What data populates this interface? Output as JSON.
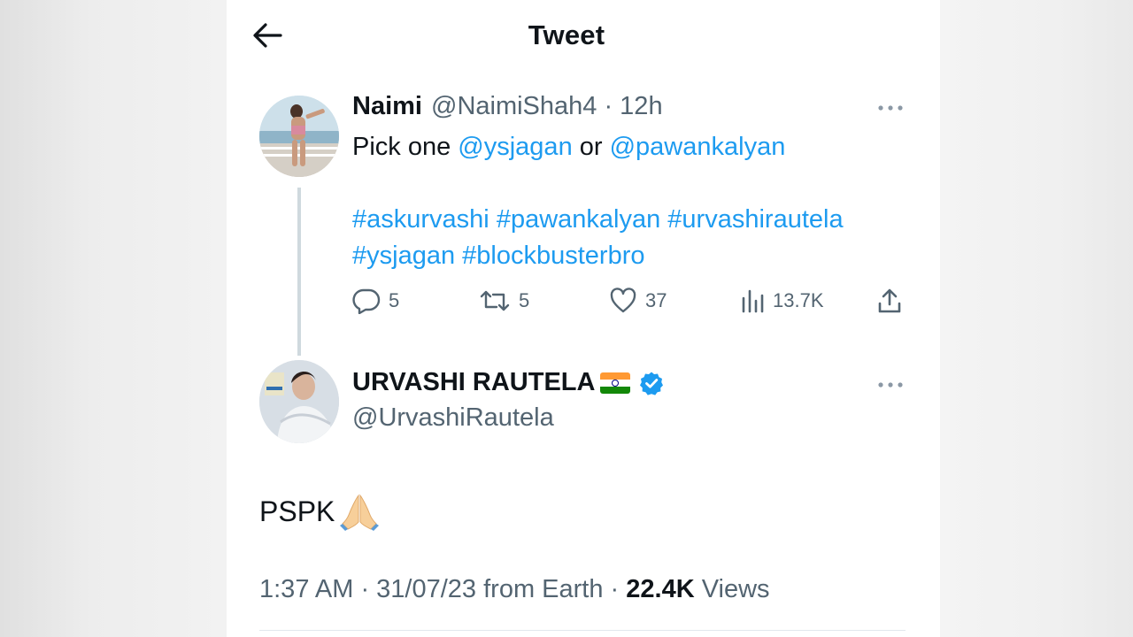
{
  "header": {
    "title": "Tweet",
    "back_icon": "arrow-left-icon"
  },
  "tweet1": {
    "author_name": "Naimi",
    "handle_time": "@NaimiShah4 · 12h",
    "text_prefix": "Pick one ",
    "mention1": "@ysjagan",
    "text_mid": " or ",
    "mention2": "@pawankalyan",
    "hashtags_line1": [
      "#askurvashi",
      "#pawankalyan",
      "#urvashirautela"
    ],
    "hashtags_line2": [
      "#ysjagan",
      "#blockbusterbro"
    ],
    "replies": "5",
    "retweets": "5",
    "likes": "37",
    "views": "13.7K"
  },
  "tweet2": {
    "author_name": "URVASHI RAUTELA",
    "handle": "@UrvashiRautela",
    "text": "PSPK",
    "timestamp_source": "1:37 AM · 31/07/23 from Earth · ",
    "views_count": "22.4K",
    "views_label": " Views"
  },
  "colors": {
    "link": "#1d9bf0",
    "secondary_text": "#536471",
    "primary_text": "#0f1419",
    "verified": "#1d9bf0"
  }
}
